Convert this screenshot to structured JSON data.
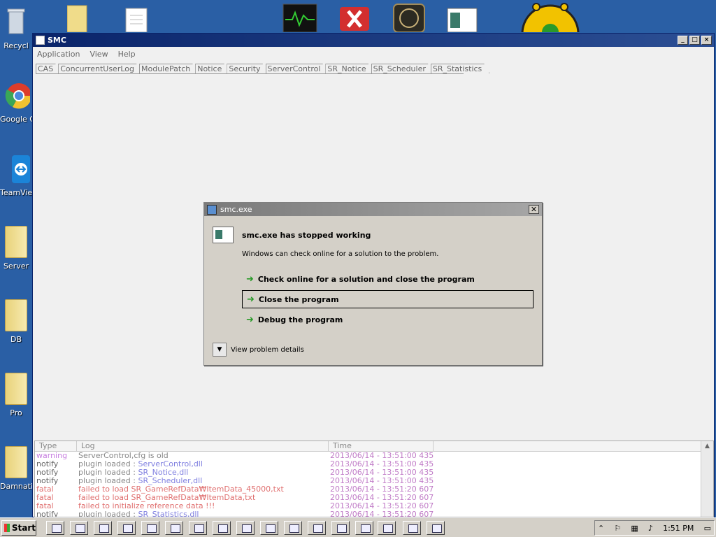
{
  "desktop": {
    "icons": [
      {
        "label": "Recycl",
        "name": "recycle-bin"
      },
      {
        "label": "Google C",
        "name": "google-chrome"
      },
      {
        "label": "TeamVie",
        "name": "teamviewer"
      },
      {
        "label": "Server",
        "name": "server-folder"
      },
      {
        "label": "DB",
        "name": "db-folder"
      },
      {
        "label": "Pro",
        "name": "pro-folder"
      },
      {
        "label": "Damnati",
        "name": "damnation-folder"
      }
    ]
  },
  "window": {
    "title": "SMC",
    "menu": [
      "Application",
      "View",
      "Help"
    ],
    "tabs": [
      "CAS",
      "ConcurrentUserLog",
      "ModulePatch",
      "Notice",
      "Security",
      "ServerControl",
      "SR_Notice",
      "SR_Scheduler",
      "SR_Statistics"
    ]
  },
  "log": {
    "headers": {
      "type": "Type",
      "log": "Log",
      "time": "Time"
    },
    "rows": [
      {
        "type": "warning",
        "prefix": "ServerControl,cfg is old",
        "suffix": "",
        "time": "2013/06/14 - 13:51:00 435"
      },
      {
        "type": "notify",
        "prefix": "plugin loaded : ",
        "suffix": "ServerControl,dll",
        "time": "2013/06/14 - 13:51:00 435"
      },
      {
        "type": "notify",
        "prefix": "plugin loaded : ",
        "suffix": "SR_Notice,dll",
        "time": "2013/06/14 - 13:51:00 435"
      },
      {
        "type": "notify",
        "prefix": "plugin loaded : ",
        "suffix": "SR_Scheduler,dll",
        "time": "2013/06/14 - 13:51:00 435"
      },
      {
        "type": "fatal",
        "prefix": "failed to load ",
        "suffix": "SR_GameRefData₩ItemData_45000,txt",
        "time": "2013/06/14 - 13:51:20 607"
      },
      {
        "type": "fatal",
        "prefix": "failed to load ",
        "suffix": "SR_GameRefData₩ItemData,txt",
        "time": "2013/06/14 - 13:51:20 607"
      },
      {
        "type": "fatal",
        "prefix": "failed to initialize reference data !!!",
        "suffix": "",
        "time": "2013/06/14 - 13:51:20 607"
      },
      {
        "type": "notify",
        "prefix": "plugin loaded : ",
        "suffix": "SR_Statistics,dll",
        "time": "2013/06/14 - 13:51:20 607"
      }
    ]
  },
  "dialog": {
    "title": "smc.exe",
    "heading": "smc.exe has stopped working",
    "subtitle": "Windows can check online for a solution to the problem.",
    "options": [
      "Check online for a solution and close the program",
      "Close the program",
      "Debug the program"
    ],
    "details": "View problem details"
  },
  "taskbar": {
    "start": "Start",
    "clock": "1:51 PM"
  }
}
